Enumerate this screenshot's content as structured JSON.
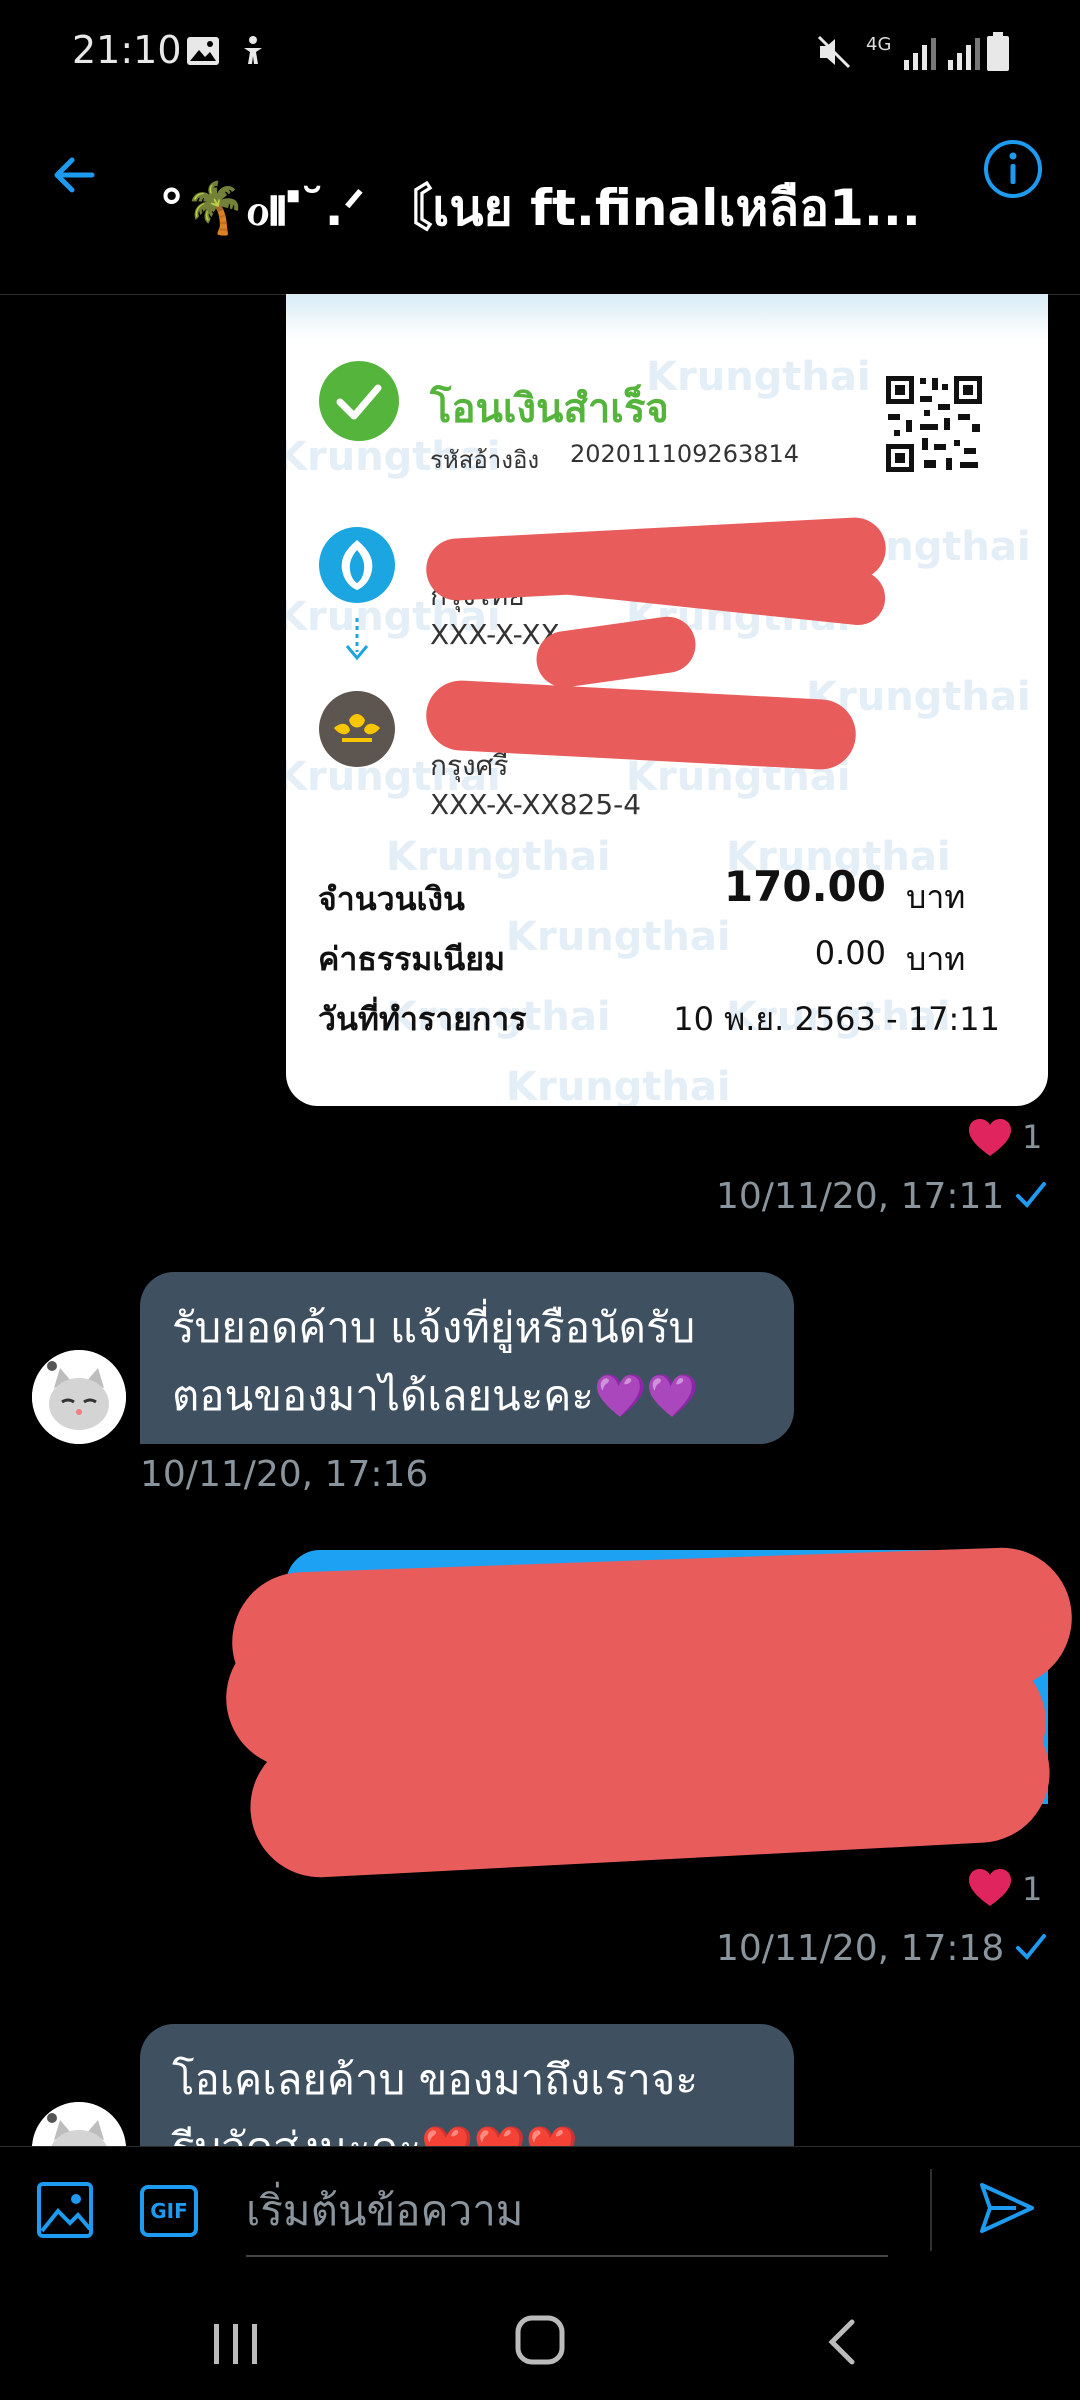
{
  "status_bar": {
    "time": "21:10",
    "network": "4G"
  },
  "header": {
    "title": "°🌴ℴ⑈˘.ᐟ 〘เนย ft.finalเหลือ1..."
  },
  "receipt": {
    "title": "โอนเงินสำเร็จ",
    "ref_label": "รหัสอ้างอิง",
    "ref_value": "202011109263814",
    "sender_bank": "กรุงไทย",
    "sender_account": "XXX-X-XX",
    "receiver_bank": "กรุงศรี",
    "receiver_account": "XXX-X-XX825-4",
    "amount_label": "จำนวนเงิน",
    "amount_value": "170.00",
    "amount_unit": "บาท",
    "fee_label": "ค่าธรรมเนียม",
    "fee_value": "0.00",
    "fee_unit": "บาท",
    "date_label": "วันที่ทำรายการ",
    "date_value": "10 พ.ย. 2563 - 17:11",
    "watermark": "Krungthai"
  },
  "messages": [
    {
      "reaction_count": "1",
      "timestamp": "10/11/20, 17:11"
    },
    {
      "text_line1": "รับยอดค้าบ แจ้งที่ยู่หรือนัดรับ",
      "text_line2": "ตอนของมาได้เลยนะคะ💜💜",
      "timestamp": "10/11/20, 17:16"
    },
    {
      "reaction_count": "1",
      "timestamp": "10/11/20, 17:18"
    },
    {
      "text_line1": "โอเคเลยค้าบ ของมาถึงเราจะ",
      "text_line2": "รีบจัดส่งนะคะ❤️❤️❤️"
    }
  ],
  "compose": {
    "placeholder": "เริ่มต้นข้อความ",
    "gif_label": "GIF"
  },
  "colors": {
    "accent": "#1d9bf0",
    "incoming_bubble": "#3f5060",
    "heart": "#e0245e",
    "success_green": "#54b43c",
    "redaction": "#e85c5c"
  }
}
